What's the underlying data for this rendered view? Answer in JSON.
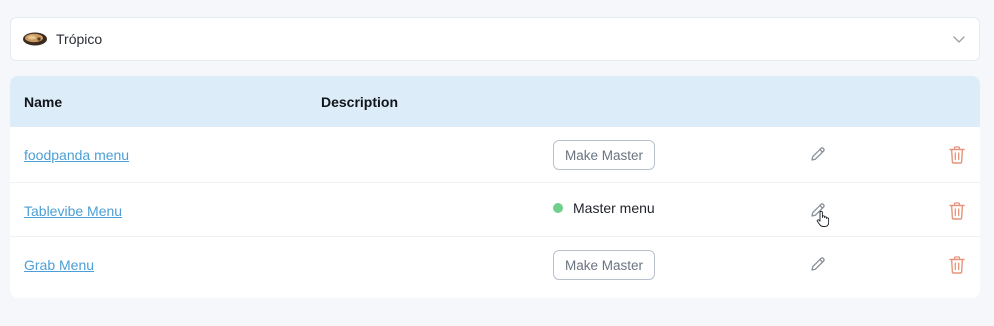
{
  "restaurant_select": {
    "value": "Trópico",
    "logo_icon": "restaurant-logo-icon",
    "chevron_icon": "chevron-down-icon"
  },
  "table": {
    "headers": {
      "name": "Name",
      "description": "Description"
    },
    "rows": [
      {
        "name": "foodpanda menu",
        "description": "",
        "status": "action",
        "action_label": "Make Master"
      },
      {
        "name": "Tablevibe Menu",
        "description": "",
        "status": "master",
        "status_label": "Master menu"
      },
      {
        "name": "Grab Menu",
        "description": "",
        "status": "action",
        "action_label": "Make Master"
      }
    ]
  },
  "colors": {
    "link": "#4b9fd6",
    "header_bg": "#ddecf9",
    "master_dot": "#6fcf8b",
    "delete_icon": "#e8937a",
    "edit_icon": "#8a9099"
  }
}
